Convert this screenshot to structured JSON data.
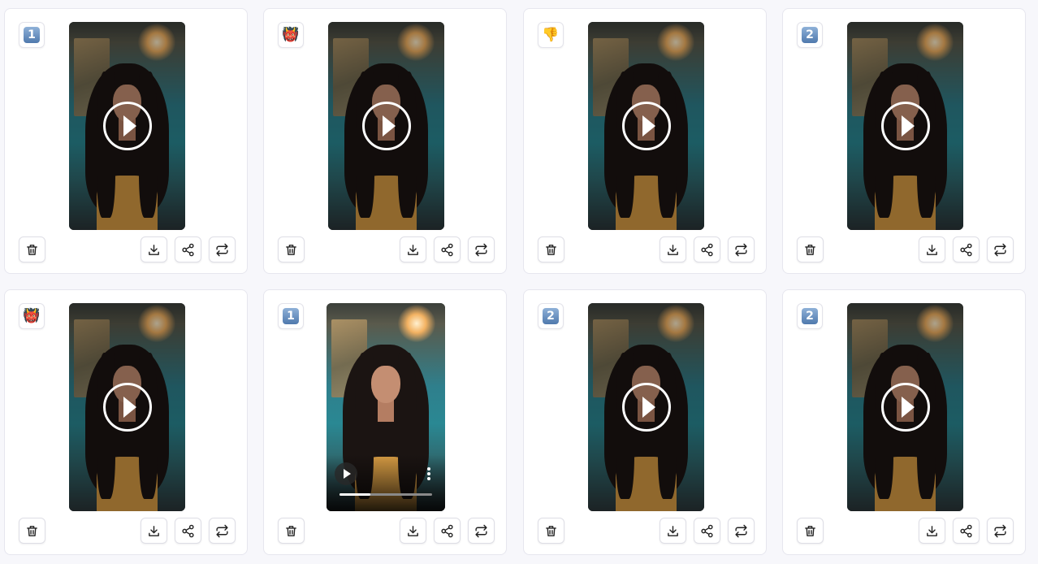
{
  "cards": [
    {
      "badge": "1",
      "badge_type": "keycap",
      "state": "paused"
    },
    {
      "badge": "👹",
      "badge_type": "emoji",
      "state": "paused"
    },
    {
      "badge": "👎",
      "badge_type": "emoji",
      "state": "paused"
    },
    {
      "badge": "2",
      "badge_type": "keycap",
      "state": "paused"
    },
    {
      "badge": "👹",
      "badge_type": "emoji",
      "state": "paused"
    },
    {
      "badge": "1",
      "badge_type": "keycap",
      "state": "playing",
      "progress": 0.33
    },
    {
      "badge": "2",
      "badge_type": "keycap",
      "state": "paused"
    },
    {
      "badge": "2",
      "badge_type": "keycap",
      "state": "paused"
    }
  ],
  "actions": {
    "delete": "trash-icon",
    "download": "download-icon",
    "share": "share-icon",
    "repost": "repost-icon"
  },
  "colors": {
    "page_bg": "#f7f7fb",
    "card_bg": "#ffffff",
    "card_border": "#e6e6ee"
  }
}
